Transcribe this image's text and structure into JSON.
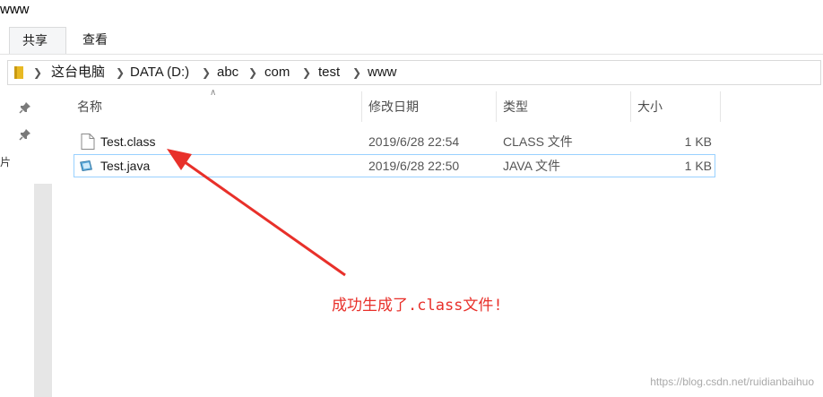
{
  "window": {
    "title": "www"
  },
  "ribbon": {
    "tabs": [
      {
        "label": "共享"
      },
      {
        "label": "查看"
      }
    ]
  },
  "address": {
    "crumbs": [
      "这台电脑",
      "DATA (D:)",
      "abc",
      "com",
      "test",
      "www"
    ]
  },
  "columns": {
    "name": "名称",
    "modified": "修改日期",
    "type": "类型",
    "size": "大小"
  },
  "files": [
    {
      "name": "Test.class",
      "modified": "2019/6/28 22:54",
      "type": "CLASS 文件",
      "size": "1 KB"
    },
    {
      "name": "Test.java",
      "modified": "2019/6/28 22:50",
      "type": "JAVA 文件",
      "size": "1 KB"
    }
  ],
  "nav": {
    "cut_text": "片"
  },
  "annotation": {
    "text": "成功生成了.class文件!",
    "color": "#e8302a"
  },
  "watermark": "https://blog.csdn.net/ruidianbaihuo"
}
